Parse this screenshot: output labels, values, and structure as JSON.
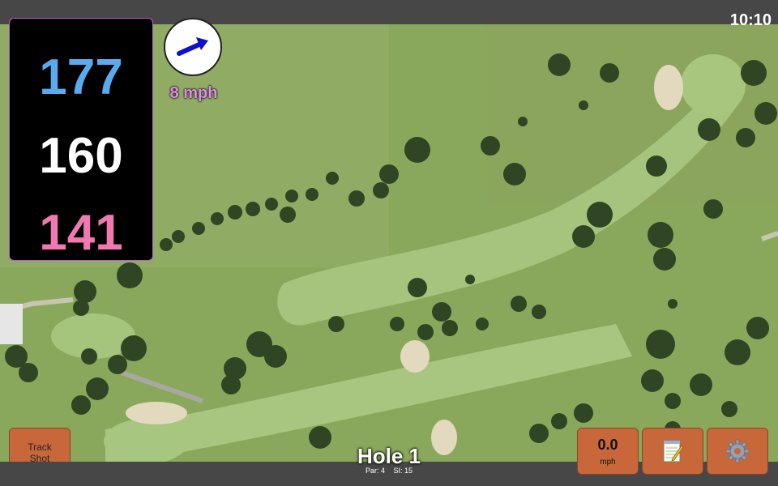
{
  "status": {
    "time": "10:10"
  },
  "distances": {
    "back": "177",
    "middle": "160",
    "front": "141"
  },
  "wind": {
    "speed": "8 mph",
    "icon": "wind-direction-arrow-icon"
  },
  "hole": {
    "title": "Hole 1",
    "par": "Par: 4",
    "stroke_index": "SI: 15"
  },
  "buttons": {
    "track_shot_line1": "Track",
    "track_shot_line2": "Shot",
    "speed_value": "0.0",
    "speed_unit": "mph",
    "notes_icon": "notepad-icon",
    "settings_icon": "gear-icon"
  },
  "colors": {
    "back_distance": "#5aaaf0",
    "middle_distance": "#ffffff",
    "front_distance": "#f07ab0",
    "wind_label": "#e38ce9",
    "button_bg": "#c8683a",
    "bar_bg": "#474747"
  }
}
